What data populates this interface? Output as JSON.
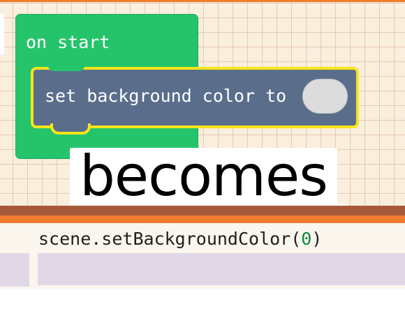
{
  "blocks": {
    "hat_label": "on start",
    "command_label": "set background color to",
    "color_value_hex": "#dcdcdc",
    "hat_color": "#25c46b",
    "command_color": "#5a6e8c",
    "highlight_color": "#f7e41a"
  },
  "caption": {
    "text": "becomes"
  },
  "code": {
    "prefix": "scene.setBackgroundColor(",
    "arg": "0",
    "suffix": ")"
  }
}
